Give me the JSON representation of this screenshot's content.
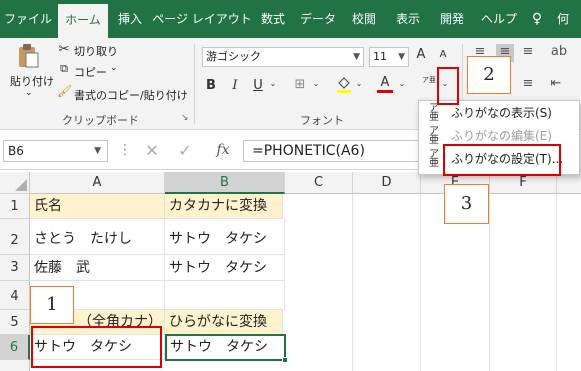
{
  "tabs": [
    {
      "label": "ファイル"
    },
    {
      "label": "ホーム"
    },
    {
      "label": "挿入"
    },
    {
      "label": "ページ レイアウト"
    },
    {
      "label": "数式"
    },
    {
      "label": "データ"
    },
    {
      "label": "校閲"
    },
    {
      "label": "表示"
    },
    {
      "label": "開発"
    },
    {
      "label": "ヘルプ"
    },
    {
      "label": "何"
    }
  ],
  "clipboard": {
    "paste": "貼り付け",
    "cut": "切り取り",
    "copy": "コピー",
    "format_painter": "書式のコピー/貼り付け",
    "group_label": "クリップボード"
  },
  "font": {
    "font_name": "游ゴシック",
    "font_size": "11",
    "group_label": "フォント",
    "bold": "B",
    "italic": "I",
    "underline": "U",
    "grow": "A",
    "shrink": "A",
    "font_color": "A",
    "furigana_glyph": "ア亜"
  },
  "formula_bar": {
    "name_box": "B6",
    "fx": "fx",
    "formula": "=PHONETIC(A6)"
  },
  "dropdown": {
    "items": [
      {
        "label": "ふりがなの表示(S)",
        "enabled": true
      },
      {
        "label": "ふりがなの編集(E)",
        "enabled": false
      },
      {
        "label": "ふりがなの設定(T)...",
        "enabled": true
      }
    ]
  },
  "grid": {
    "columns": [
      "A",
      "B",
      "C",
      "D",
      "E",
      "F"
    ],
    "rows": [
      {
        "num": "1",
        "a": "氏名",
        "b": "カタカナに変換"
      },
      {
        "num": "2",
        "a": "さとう　たけし",
        "b": "サトウ　タケシ"
      },
      {
        "num": "3",
        "a": "佐藤　武",
        "b": "サトウ　タケシ"
      },
      {
        "num": "4",
        "a": "",
        "b": ""
      },
      {
        "num": "5",
        "a": "（全角カナ）",
        "b": "ひらがなに変換"
      },
      {
        "num": "6",
        "a": "サトウ　タケシ",
        "b": "サトウ　タケシ"
      }
    ]
  },
  "annotations": {
    "step1": "1",
    "step2": "2",
    "step3": "3"
  },
  "colors": {
    "excel_green": "#217346",
    "highlight": "#fff2cc",
    "callout_red": "#e00000",
    "callout_orange": "#ed7d31"
  }
}
